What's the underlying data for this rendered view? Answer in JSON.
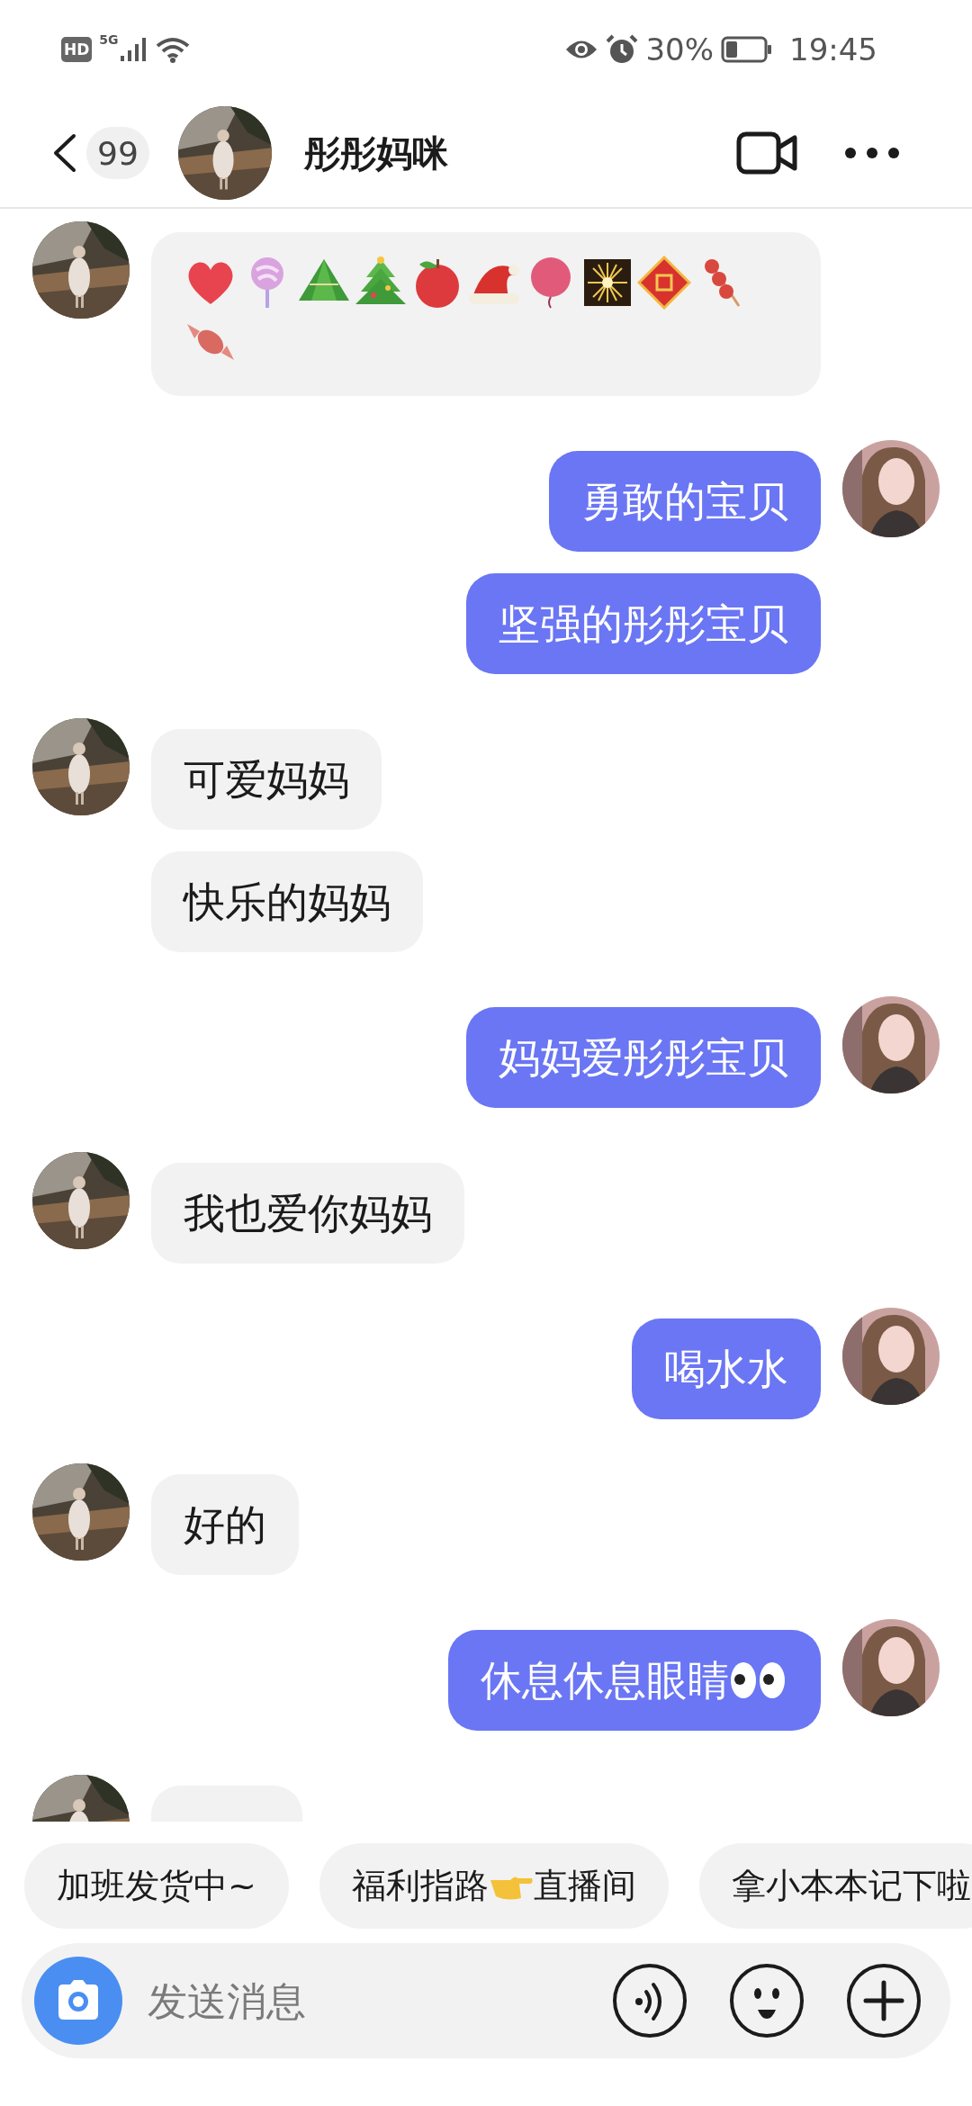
{
  "status_bar": {
    "hd": "HD",
    "network": "5G",
    "battery": "30%",
    "time": "19:45"
  },
  "header": {
    "back_badge": "99",
    "title": "彤彤妈咪"
  },
  "messages": [
    {
      "outgoing": false,
      "bubbles": [
        {
          "kind": "stickers"
        }
      ]
    },
    {
      "outgoing": true,
      "bubbles": [
        {
          "kind": "text",
          "text": "勇敢的宝贝"
        },
        {
          "kind": "text",
          "text": "坚强的彤彤宝贝"
        }
      ]
    },
    {
      "outgoing": false,
      "bubbles": [
        {
          "kind": "text",
          "text": "可爱妈妈"
        },
        {
          "kind": "text",
          "text": "快乐的妈妈"
        }
      ]
    },
    {
      "outgoing": true,
      "bubbles": [
        {
          "kind": "text",
          "text": "妈妈爱彤彤宝贝"
        }
      ]
    },
    {
      "outgoing": false,
      "bubbles": [
        {
          "kind": "text",
          "text": "我也爱你妈妈"
        }
      ]
    },
    {
      "outgoing": true,
      "bubbles": [
        {
          "kind": "text",
          "text": "喝水水"
        }
      ]
    },
    {
      "outgoing": false,
      "bubbles": [
        {
          "kind": "text",
          "text": "好的"
        }
      ]
    },
    {
      "outgoing": true,
      "bubbles": [
        {
          "kind": "texteyes",
          "text": "休息休息眼睛"
        }
      ]
    },
    {
      "outgoing": false,
      "bubbles": [
        {
          "kind": "hidden"
        }
      ]
    }
  ],
  "quick_replies": [
    {
      "kind": "plain",
      "text": "加班发货中~"
    },
    {
      "kind": "pointer",
      "text": "福利指路",
      "text_after": "直播间"
    },
    {
      "kind": "plain",
      "text": "拿小本本记下啦"
    }
  ],
  "composer": {
    "placeholder": "发送消息"
  }
}
